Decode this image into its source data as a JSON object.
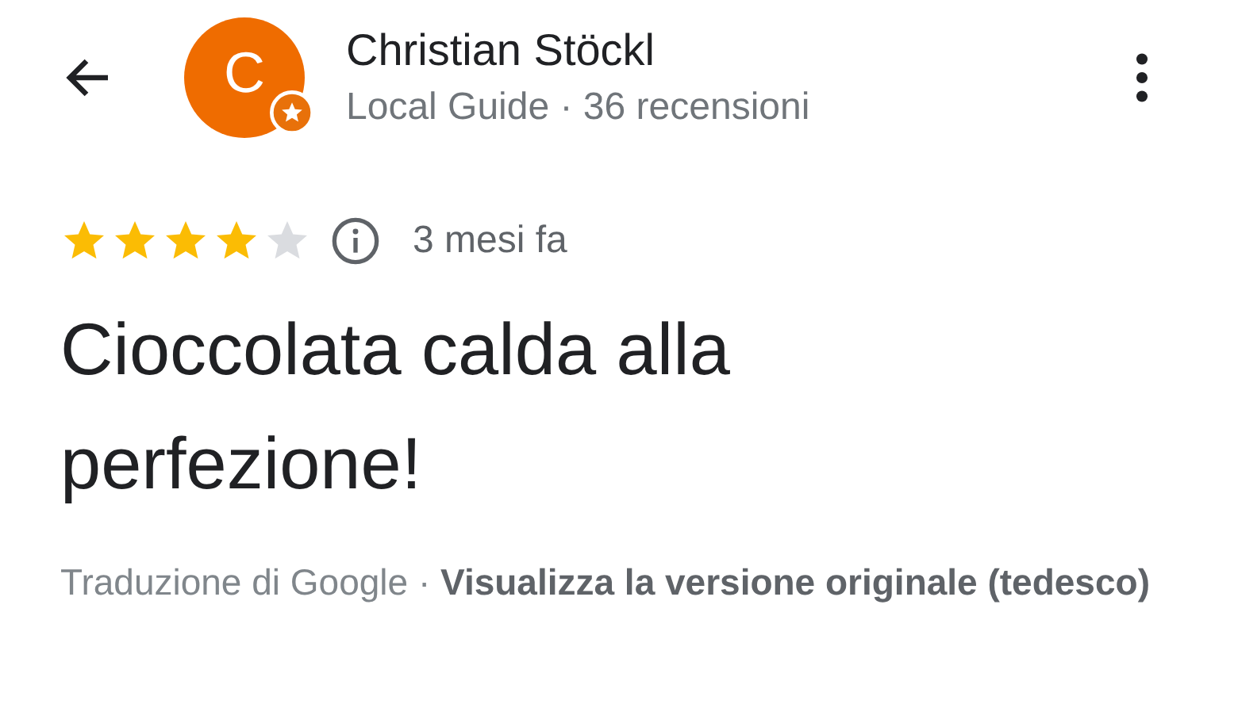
{
  "author": {
    "avatar_letter": "C",
    "local_guide_badge": true,
    "name": "Christian Stöckl",
    "subtitle": "Local Guide · 36 recensioni"
  },
  "review": {
    "stars": 4,
    "time": "3 mesi fa",
    "text": "Cioccolata calda alla perfezione!",
    "translation": "Traduzione di Google · **Visualizza la versione originale (tedesco)**"
  }
}
